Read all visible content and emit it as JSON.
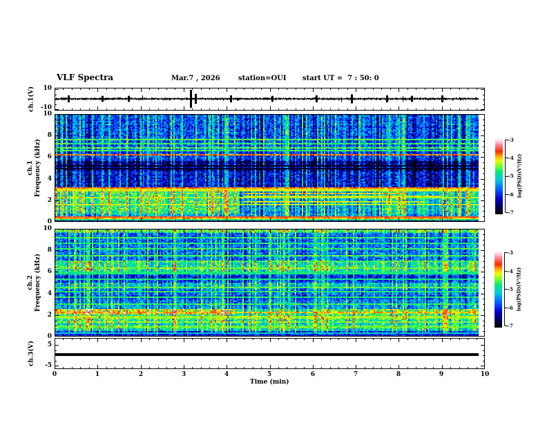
{
  "header": {
    "title": "VLF Spectra",
    "date": "Mar.7 , 2026",
    "station": "station=OUI",
    "start_ut": "start UT =  7 : 50: 0"
  },
  "axes": {
    "x": {
      "label": "Time (min)",
      "ticks": [
        "0",
        "1",
        "2",
        "3",
        "4",
        "5",
        "6",
        "7",
        "8",
        "9",
        "10"
      ]
    },
    "ch1_volt": {
      "label": "ch.1(V)",
      "ticks": [
        "10",
        "-10"
      ]
    },
    "spec1": {
      "label_channel": "ch.1",
      "label_freq": "Frequency (kHz)",
      "ticks": [
        "10",
        "8",
        "6",
        "4",
        "2",
        "0"
      ]
    },
    "spec2": {
      "label_channel": "ch.2",
      "label_freq": "Frequency (kHz)",
      "ticks": [
        "10",
        "8",
        "6",
        "4",
        "2",
        "0"
      ]
    },
    "ch3_volt": {
      "label": "ch.3(V)",
      "ticks": [
        "5",
        "-5"
      ]
    }
  },
  "colorbar": {
    "label": "log(PSD)(V²/Hz)",
    "ticks": [
      "-3",
      "-4",
      "-5",
      "-6",
      "-7"
    ],
    "zlim": [
      -7,
      -3
    ]
  },
  "colormap_stops": [
    [
      0.0,
      "#000006"
    ],
    [
      0.08,
      "#00004d"
    ],
    [
      0.2,
      "#0000cc"
    ],
    [
      0.33,
      "#0066ff"
    ],
    [
      0.45,
      "#00ccdd"
    ],
    [
      0.55,
      "#00e87a"
    ],
    [
      0.63,
      "#7dff2e"
    ],
    [
      0.7,
      "#e8ff00"
    ],
    [
      0.76,
      "#ffa500"
    ],
    [
      0.82,
      "#ff2a00"
    ],
    [
      0.9,
      "#ff7f8e"
    ],
    [
      0.96,
      "#ffd7e2"
    ],
    [
      1.0,
      "#ffffff"
    ]
  ],
  "chart_data": [
    {
      "type": "line",
      "panel": "ch1_waveform",
      "ylabel": "ch.1(V)",
      "xlim": [
        0,
        10
      ],
      "ylim": [
        -10,
        10
      ],
      "description": "dense broadband noise trace centered on 0 V, ~±1.5 V, with intermittent impulsive spikes",
      "noise_amp": 1.25,
      "spike_probability": 0.012,
      "spikes": [
        {
          "t": 0.32,
          "a": 3.5
        },
        {
          "t": 1.1,
          "a": 3.0
        },
        {
          "t": 1.72,
          "a": 3.0
        },
        {
          "t": 3.17,
          "a": 9.0
        },
        {
          "t": 3.27,
          "a": 5.0
        },
        {
          "t": 4.1,
          "a": 3.5
        },
        {
          "t": 5.05,
          "a": 3.0
        },
        {
          "t": 6.08,
          "a": 3.5
        },
        {
          "t": 6.9,
          "a": 4.5
        },
        {
          "t": 7.72,
          "a": 3.5
        },
        {
          "t": 8.3,
          "a": 3.0
        },
        {
          "t": 9.0,
          "a": 3.5
        }
      ]
    },
    {
      "type": "heatmap",
      "panel": "ch1_spectrogram",
      "ylabel": "ch.1 Frequency (kHz)",
      "xlim": [
        0,
        10
      ],
      "ylim": [
        0,
        10
      ],
      "zlabel": "log(PSD)(V²/Hz)",
      "zlim": [
        -7,
        -3
      ],
      "description": "VLF spectrogram: blue background with broadband vertical streaks, dark band 4.7-5.6 kHz, bright hiss band 0.8-2.9 kHz strongest before 4.3 min, red narrowband lines near 6.2, 3.1 and 0.3-0.45 kHz",
      "seed": 101,
      "bands": [
        {
          "f0": 8.0,
          "f1": 10.0,
          "v": 0.3
        },
        {
          "f0": 6.5,
          "f1": 8.0,
          "v": 0.32
        },
        {
          "f0": 5.6,
          "f1": 6.5,
          "v": 0.26
        },
        {
          "f0": 4.7,
          "f1": 5.6,
          "v": 0.13
        },
        {
          "f0": 3.2,
          "f1": 4.7,
          "v": 0.21
        },
        {
          "f0": 2.9,
          "f1": 3.2,
          "v": 0.3
        },
        {
          "f0": 0.8,
          "f1": 2.9,
          "v": 0.46
        },
        {
          "f0": 0.5,
          "f1": 0.8,
          "v": 0.4
        },
        {
          "f0": 0.0,
          "f1": 0.5,
          "v": 0.16
        }
      ],
      "time_mods": [
        {
          "f0": 0.8,
          "f1": 2.9,
          "segs": [
            {
              "t0": 0,
              "t1": 4.3,
              "add": 0.1
            },
            {
              "t0": 4.3,
              "t1": 7.4,
              "add": -0.06
            },
            {
              "t0": 7.4,
              "t1": 10,
              "add": 0.04
            }
          ]
        }
      ],
      "lines": [
        {
          "f": 7.6,
          "v": 0.6
        },
        {
          "f": 7.25,
          "v": 0.58
        },
        {
          "f": 6.9,
          "v": 0.6
        },
        {
          "f": 6.55,
          "v": 0.58
        },
        {
          "f": 6.2,
          "v": 0.78
        },
        {
          "f": 5.15,
          "v": 0.05
        },
        {
          "f": 4.95,
          "v": 0.05
        },
        {
          "f": 3.1,
          "v": 0.78
        },
        {
          "f": 2.95,
          "v": 0.7
        },
        {
          "f": 2.65,
          "v": 0.74,
          "t0": 4.4,
          "t1": 8.2
        },
        {
          "f": 2.35,
          "v": 0.7,
          "t0": 4.4,
          "t1": 9.0
        },
        {
          "f": 2.2,
          "v": 0.65
        },
        {
          "f": 1.9,
          "v": 0.7,
          "t0": 4.4,
          "t1": 8.6
        },
        {
          "f": 1.55,
          "v": 0.66
        },
        {
          "f": 0.42,
          "v": 0.82
        },
        {
          "f": 0.28,
          "v": 0.75
        },
        {
          "f": 0.15,
          "v": 0.55
        }
      ],
      "streaks": {
        "p_bright": 0.14,
        "add_bright": 0.24,
        "p_mid": 0.16,
        "add_mid": 0.11,
        "p_dark": 0.14,
        "add_dark": -0.14,
        "fmin": 0.55
      }
    },
    {
      "type": "heatmap",
      "panel": "ch2_spectrogram",
      "ylabel": "ch.2 Frequency (kHz)",
      "xlim": [
        0,
        10
      ],
      "ylim": [
        0,
        10
      ],
      "zlabel": "log(PSD)(V²/Hz)",
      "zlim": [
        -7,
        -3
      ],
      "description": "brighter cyan/green spectrogram: green band at 9.6-10 kHz, cyan hiss 6-7 kHz, strong yellow-green line band 2.05-2.6 kHz weakest 4.2-6.3 min, many thin narrowband horizontal lines",
      "seed": 202,
      "bands": [
        {
          "f0": 9.6,
          "f1": 10.0,
          "v": 0.52
        },
        {
          "f0": 7.0,
          "f1": 9.6,
          "v": 0.33
        },
        {
          "f0": 6.0,
          "f1": 7.0,
          "v": 0.5
        },
        {
          "f0": 5.0,
          "f1": 6.0,
          "v": 0.25
        },
        {
          "f0": 4.3,
          "f1": 5.0,
          "v": 0.42
        },
        {
          "f0": 3.3,
          "f1": 4.3,
          "v": 0.3
        },
        {
          "f0": 2.6,
          "f1": 3.3,
          "v": 0.35
        },
        {
          "f0": 2.05,
          "f1": 2.6,
          "v": 0.58
        },
        {
          "f0": 1.3,
          "f1": 2.05,
          "v": 0.52
        },
        {
          "f0": 0.5,
          "f1": 1.3,
          "v": 0.47
        },
        {
          "f0": 0.0,
          "f1": 0.5,
          "v": 0.24
        }
      ],
      "time_mods": [
        {
          "f0": 2.05,
          "f1": 2.6,
          "segs": [
            {
              "t0": 0,
              "t1": 4.2,
              "add": 0.1
            },
            {
              "t0": 4.2,
              "t1": 6.3,
              "add": -0.08
            },
            {
              "t0": 6.3,
              "t1": 10,
              "add": 0.02
            }
          ]
        }
      ],
      "lines": [
        {
          "f": 9.8,
          "v": 0.6
        },
        {
          "f": 9.2,
          "v": 0.58
        },
        {
          "f": 8.7,
          "v": 0.56
        },
        {
          "f": 8.1,
          "v": 0.58
        },
        {
          "f": 7.5,
          "v": 0.6
        },
        {
          "f": 7.0,
          "v": 0.58
        },
        {
          "f": 6.4,
          "v": 0.62
        },
        {
          "f": 5.9,
          "v": 0.55
        },
        {
          "f": 5.3,
          "v": 0.55
        },
        {
          "f": 4.6,
          "v": 0.6
        },
        {
          "f": 4.15,
          "v": 0.56
        },
        {
          "f": 3.6,
          "v": 0.56
        },
        {
          "f": 3.05,
          "v": 0.58
        },
        {
          "f": 2.3,
          "v": 0.74
        },
        {
          "f": 1.8,
          "v": 0.64
        },
        {
          "f": 1.35,
          "v": 0.62
        },
        {
          "f": 0.9,
          "v": 0.6
        },
        {
          "f": 0.35,
          "v": 0.45
        }
      ],
      "streaks": {
        "p_bright": 0.17,
        "add_bright": 0.22,
        "p_mid": 0.18,
        "add_mid": 0.1,
        "p_dark": 0.1,
        "add_dark": -0.12,
        "fmin": 0.3
      }
    },
    {
      "type": "line",
      "panel": "ch3_waveform",
      "ylabel": "ch.3(V)",
      "xlim": [
        0,
        10
      ],
      "ylim": [
        -5,
        5
      ],
      "description": "flat constant trace drawn as a thick black horizontal bar just above 0 V",
      "constant_value": 0.3,
      "thickness_v": 1.3
    }
  ]
}
